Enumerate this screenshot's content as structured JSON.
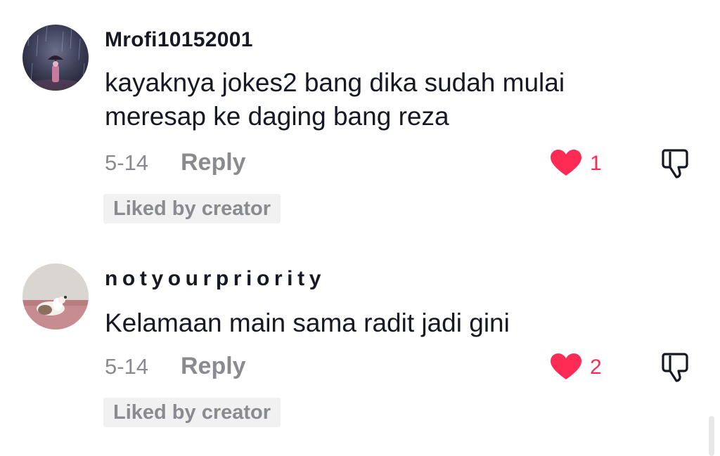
{
  "comments": [
    {
      "username": "Mrofi10152001",
      "text": "kayaknya jokes2 bang dika sudah mulai meresap ke daging bang reza",
      "date": "5-14",
      "reply_label": "Reply",
      "like_count": "1",
      "badge": "Liked by creator",
      "avatar": "night-rain-umbrella-avatar"
    },
    {
      "username": "notyourpriority",
      "text": "Kelamaan main sama radit jadi gini",
      "date": "5-14",
      "reply_label": "Reply",
      "like_count": "2",
      "badge": "Liked by creator",
      "avatar": "cat-lying-avatar"
    }
  ],
  "colors": {
    "like_red": "#fe2c55",
    "muted_gray": "#8a8b91",
    "text_dark": "#161823",
    "badge_bg": "#f1f1f2"
  },
  "icons": {
    "like": "heart-icon",
    "dislike": "thumbs-down-icon"
  }
}
